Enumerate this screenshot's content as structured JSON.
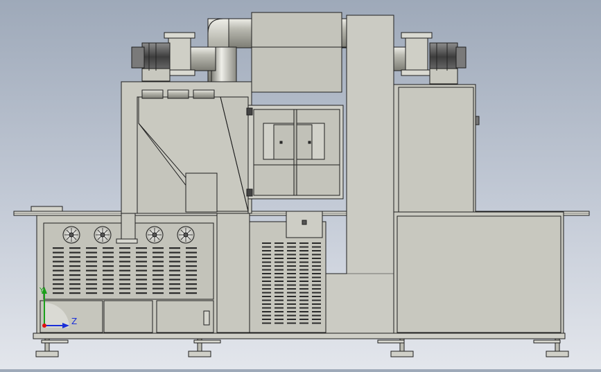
{
  "viewport": {
    "background_top": "#9ea9b9",
    "background_bottom": "#e3e6ec",
    "part_fill": "#c8c8bf",
    "part_fill_light": "#d6d6ce",
    "edge_color": "#1e1e1e"
  },
  "triad": {
    "axis_z_label": "Z",
    "axis_y_label": "Y",
    "axis_z_color": "#1a2fd8",
    "axis_y_color": "#1aa01a",
    "origin_color": "#e01010"
  }
}
